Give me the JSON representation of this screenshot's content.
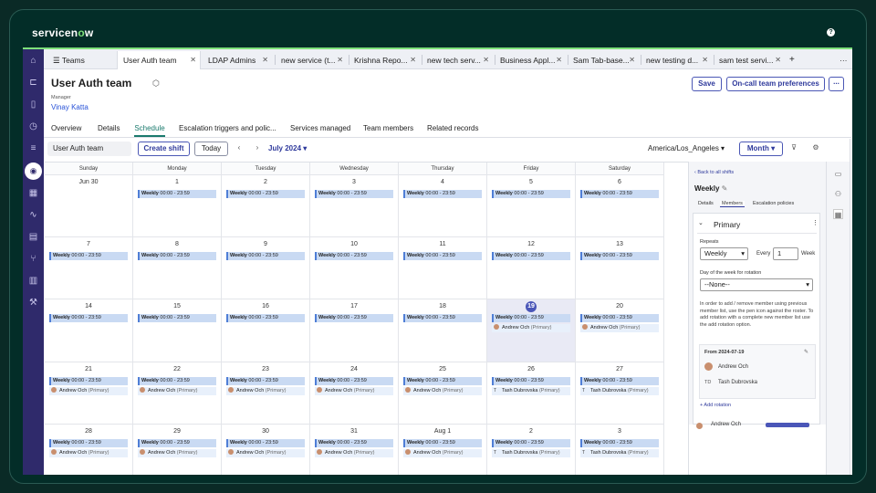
{
  "brand": {
    "name_pre": "servicen",
    "name_o": "o",
    "name_post": "w"
  },
  "window_tabs": [
    {
      "label": "Teams"
    },
    {
      "label": "User Auth team"
    },
    {
      "label": "LDAP Admins"
    },
    {
      "label": "new service (t..."
    },
    {
      "label": "Krishna Repo..."
    },
    {
      "label": "new tech serv..."
    },
    {
      "label": "Business Appl..."
    },
    {
      "label": "Sam Tab-base..."
    },
    {
      "label": "new testing d..."
    },
    {
      "label": "sam test servi..."
    }
  ],
  "header": {
    "title": "User Auth team",
    "manager_label": "Manager",
    "manager_name": "Vinay Katta",
    "save_label": "Save",
    "prefs_label": "On-call team preferences",
    "more_label": "..."
  },
  "subtabs": [
    "Overview",
    "Details",
    "Schedule",
    "Escalation triggers and polic...",
    "Services managed",
    "Team members",
    "Related records"
  ],
  "toolbar": {
    "team": "User Auth team",
    "create_shift": "Create shift",
    "today": "Today",
    "month_label": "July 2024",
    "timezone": "America/Los_Angeles",
    "view": "Month"
  },
  "calendar": {
    "weekdays": [
      "Sunday",
      "Monday",
      "Tuesday",
      "Wednesday",
      "Thursday",
      "Friday",
      "Saturday"
    ],
    "shift_name": "Weekly",
    "shift_time": "00:00 - 23:59",
    "member_role": "(Primary)",
    "weeks": [
      [
        "Jun 30",
        "1",
        "2",
        "3",
        "4",
        "5",
        "6"
      ],
      [
        "7",
        "8",
        "9",
        "10",
        "11",
        "12",
        "13"
      ],
      [
        "14",
        "15",
        "16",
        "17",
        "18",
        "19",
        "20"
      ],
      [
        "21",
        "22",
        "23",
        "24",
        "25",
        "26",
        "27"
      ],
      [
        "28",
        "29",
        "30",
        "31",
        "Aug 1",
        "2",
        "3"
      ]
    ],
    "today": "19",
    "members": {
      "andrew": "Andrew Och",
      "tash": "Tash Dubrovska",
      "tash_initial": "T"
    }
  },
  "panel": {
    "back": "Back to all shifts",
    "shift_title": "Weekly",
    "tabs": [
      "Details",
      "Members",
      "Escalation policies"
    ],
    "rotation_title": "Primary",
    "repeats_label": "Repeats",
    "repeats_value": "Weekly",
    "every_label": "Every",
    "every_value": "1",
    "week_label": "Week",
    "dow_label": "Day of the week for rotation",
    "dow_value": "--None--",
    "info_text": "In order to add / remove member using previous member list, use the pen icon against the roster. To add rotation with a complete new member list use the add rotation option.",
    "from_label": "From 2024-07-19",
    "member1": "Andrew Och",
    "member2_initials": "TD",
    "member2": "Tash Dubrovska",
    "add_rotation": "+ Add rotation",
    "partial_member": "Andrew Och"
  }
}
